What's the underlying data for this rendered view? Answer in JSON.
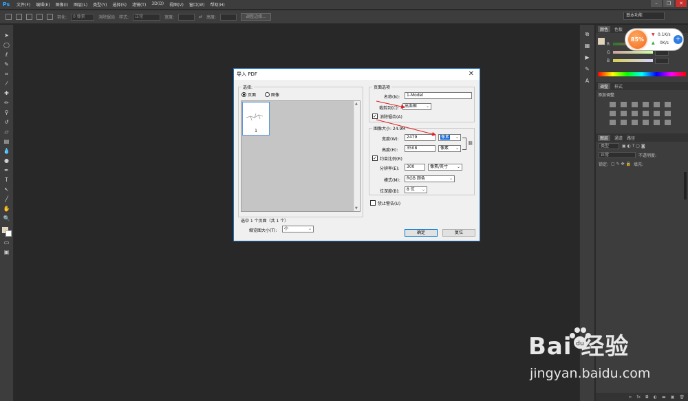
{
  "app": {
    "logo": "Ps"
  },
  "menu": [
    "文件(F)",
    "编辑(E)",
    "图像(I)",
    "图层(L)",
    "类型(Y)",
    "选择(S)",
    "滤镜(T)",
    "3D(D)",
    "视图(V)",
    "窗口(W)",
    "帮助(H)"
  ],
  "options_bar": {
    "feather_label": "羽化:",
    "feather_value": "0 像素",
    "antialias_label": "消除锯齿",
    "style_label": "样式:",
    "style_value": "正常",
    "width_label": "宽度:",
    "height_label": "高度:",
    "refine_edge": "调整边缘...",
    "workspace": "基本功能"
  },
  "speed_widget": {
    "percent": "85%",
    "upload": "0.1K/s",
    "download": "0K/s",
    "plus": "+"
  },
  "right_panel": {
    "color_tabs": [
      "颜色",
      "色板"
    ],
    "slider_labels": [
      "R",
      "G",
      "B"
    ],
    "adjust_tabs": [
      "调整",
      "样式"
    ],
    "adjust_title": "添加调整",
    "layer_tabs": [
      "图层",
      "通道",
      "路径"
    ],
    "layer_kind": "类型",
    "blend_mode": "正常",
    "opacity_label": "不透明度:",
    "lock_label": "锁定:",
    "fill_label": "填充:",
    "bottom_icons": [
      "∞",
      "fx",
      "◘",
      "◐",
      "▬",
      "▣",
      "🗑"
    ]
  },
  "dialog": {
    "title": "导入 PDF",
    "close": "✕",
    "select_group": "选择:",
    "radio_pages": "页面",
    "radio_images": "图像",
    "thumb_number": "1",
    "selected_info": "选中 1 个页面（共 1 个）",
    "thumb_size_label": "缩览图大小(T):",
    "thumb_size_value": "小",
    "page_options_group": "页面选项",
    "name_label": "名称(N):",
    "name_value": "1-Model",
    "crop_label": "裁剪到(C):",
    "crop_value": "出血框",
    "antialias_label": "消除锯齿(A)",
    "image_size_group": "图像大小: 24.9M",
    "width_label": "宽度(W):",
    "width_value": "2479",
    "width_unit": "像素",
    "height_label": "高度(H):",
    "height_value": "3508",
    "height_unit": "像素",
    "constrain_label": "约束比例(R)",
    "resolution_label": "分辨率(E):",
    "resolution_value": "300",
    "resolution_unit": "像素/英寸",
    "mode_label": "模式(M):",
    "mode_value": "RGB 颜色",
    "depth_label": "位深度(B):",
    "depth_value": "8 位",
    "suppress_label": "禁止警告(U)",
    "ok": "确定",
    "reset": "复位"
  },
  "watermark": {
    "logo": "Bai  经验",
    "url": "jingyan.baidu.com"
  },
  "colors": {
    "accent": "#0078d7",
    "arrow": "#e02020",
    "ps_blue": "#31a8ff",
    "fg_swatch": "#e6d2b0"
  }
}
